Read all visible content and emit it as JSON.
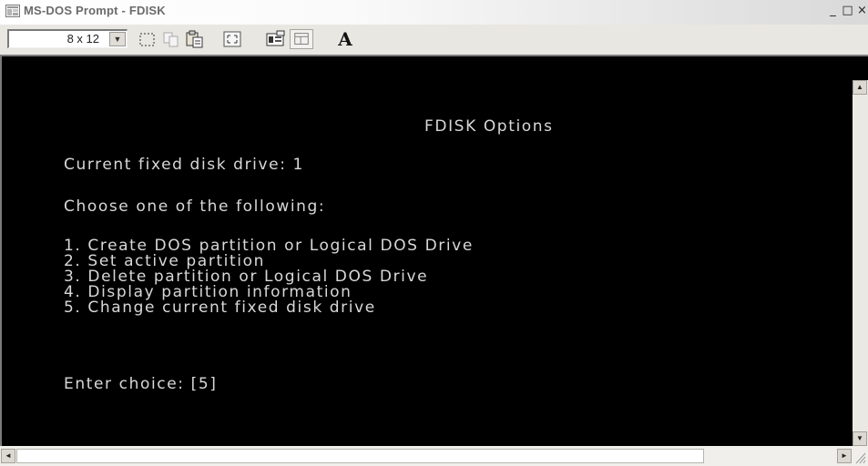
{
  "window": {
    "title": "MS-DOS Prompt - FDISK",
    "controls": {
      "minimize": "_",
      "maximize": "□",
      "close": "×"
    }
  },
  "toolbar": {
    "font_size_value": "8 x 12",
    "buttons": [
      "mark-icon",
      "copy-icon",
      "paste-icon",
      "full-screen-icon",
      "properties-icon",
      "background-icon",
      "font-icon"
    ],
    "font_button_label": "A"
  },
  "console": {
    "title": "FDISK Options",
    "current_drive": "Current fixed disk drive: 1",
    "prompt": "Choose one of the following:",
    "options": [
      "1. Create DOS partition or Logical DOS Drive",
      "2. Set active partition",
      "3. Delete partition or Logical DOS Drive",
      "4. Display partition information",
      "5. Change current fixed disk drive"
    ],
    "enter_choice": "Enter choice: [5]"
  },
  "scrollbars": {
    "up_arrow": "▲",
    "down_arrow": "▼",
    "left_arrow": "◄",
    "right_arrow": "►"
  },
  "colors": {
    "console_bg": "#000000",
    "console_text": "#d8d8d8",
    "chrome": "#d4d0c8"
  }
}
